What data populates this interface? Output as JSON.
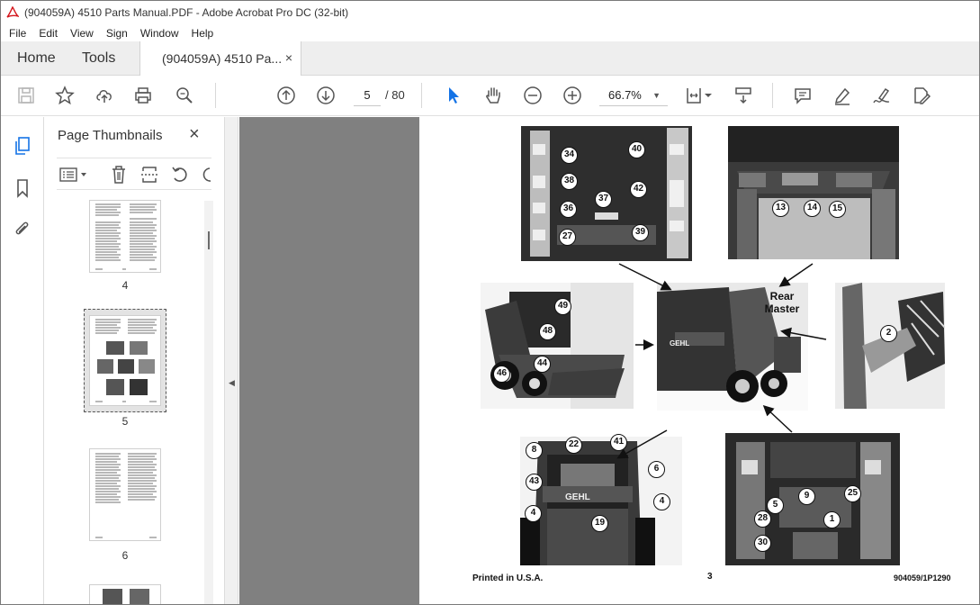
{
  "window": {
    "title": "(904059A) 4510 Parts Manual.PDF - Adobe Acrobat Pro DC (32-bit)",
    "app_icon": "acrobat-icon"
  },
  "menu": [
    "File",
    "Edit",
    "View",
    "Sign",
    "Window",
    "Help"
  ],
  "tabs": {
    "home": "Home",
    "tools": "Tools",
    "document": "(904059A) 4510 Pa...",
    "close": "×"
  },
  "toolbar": {
    "icons": [
      "save-icon",
      "bookmark-star-icon",
      "upload-icon",
      "print-icon",
      "zoom-search-icon",
      "prev-page-icon",
      "next-page-icon",
      "select-cursor-icon",
      "hand-tool-icon",
      "zoom-out-icon",
      "zoom-in-icon",
      "fit-page-icon",
      "scroll-mode-icon",
      "comment-icon",
      "highlight-icon",
      "sign-icon",
      "fill-sign-icon"
    ],
    "page_current": "5",
    "page_total": "/ 80",
    "zoom": "66.7%",
    "active_color": "#1473e6"
  },
  "thumbnails": {
    "title": "Page Thumbnails",
    "close": "×",
    "pages": [
      {
        "label": "4"
      },
      {
        "label": "5",
        "selected": true
      },
      {
        "label": "6"
      }
    ]
  },
  "pdf_page": {
    "rear_label": "Rear\nMaster",
    "footer_left": "Printed in U.S.A.",
    "footer_center": "3",
    "footer_right": "904059/1P1290",
    "callouts": [
      "34",
      "40",
      "38",
      "42",
      "37",
      "36",
      "27",
      "39",
      "13",
      "14",
      "15",
      "49",
      "48",
      "44",
      "46",
      "2",
      "8",
      "22",
      "41",
      "6",
      "43",
      "4",
      "19",
      "4",
      "9",
      "25",
      "5",
      "28",
      "1",
      "30"
    ]
  }
}
